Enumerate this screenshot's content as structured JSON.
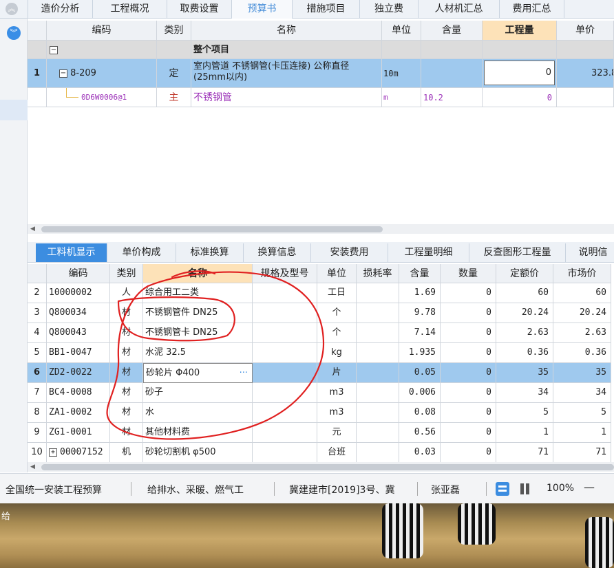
{
  "top_tabs": [
    "造价分析",
    "工程概况",
    "取费设置",
    "预算书",
    "措施项目",
    "独立费",
    "人材机汇总",
    "费用汇总"
  ],
  "top_tab_active": "预算书",
  "upper_grid": {
    "headers": [
      "编码",
      "类别",
      "名称",
      "单位",
      "含量",
      "工程量",
      "单价"
    ],
    "rows": [
      {
        "num": "",
        "code": "",
        "type": "",
        "name": "整个项目",
        "unit": "",
        "content": "",
        "qty": "",
        "price": ""
      },
      {
        "num": "1",
        "code": "8-209",
        "type": "定",
        "name_line1": "室内管道 不锈钢管(卡压连接) 公称直径",
        "name_line2": "(25mm以内)",
        "unit": "10m",
        "content": "",
        "qty": "0",
        "price": "323.8"
      },
      {
        "num": "",
        "code": "0D6W0006@1",
        "type": "主",
        "name": "不锈钢管",
        "unit": "m",
        "content": "10.2",
        "qty": "0",
        "price": ""
      }
    ],
    "expand_symbol": "−"
  },
  "lower_tabs": [
    "工料机显示",
    "单价构成",
    "标准换算",
    "换算信息",
    "安装费用",
    "工程量明细",
    "反查图形工程量",
    "说明信"
  ],
  "lower_tab_active": "工料机显示",
  "lower_grid": {
    "headers": [
      "编码",
      "类别",
      "名称",
      "规格及型号",
      "单位",
      "损耗率",
      "含量",
      "数量",
      "定额价",
      "市场价"
    ],
    "rows": [
      {
        "num": "2",
        "code": "10000002",
        "type": "人",
        "name": "综合用工二类",
        "spec": "",
        "unit": "工日",
        "loss": "",
        "content": "1.69",
        "qty": "0",
        "quota": "60",
        "market": "60"
      },
      {
        "num": "3",
        "code": "Q800034",
        "type": "材",
        "name": "不锈钢管件 DN25",
        "spec": "",
        "unit": "个",
        "loss": "",
        "content": "9.78",
        "qty": "0",
        "quota": "20.24",
        "market": "20.24"
      },
      {
        "num": "4",
        "code": "Q800043",
        "type": "材",
        "name": "不锈钢管卡 DN25",
        "spec": "",
        "unit": "个",
        "loss": "",
        "content": "7.14",
        "qty": "0",
        "quota": "2.63",
        "market": "2.63"
      },
      {
        "num": "5",
        "code": "BB1-0047",
        "type": "材",
        "name": "水泥 32.5",
        "spec": "",
        "unit": "kg",
        "loss": "",
        "content": "1.935",
        "qty": "0",
        "quota": "0.36",
        "market": "0.36"
      },
      {
        "num": "6",
        "code": "ZD2-0022",
        "type": "材",
        "name": "砂轮片 Φ400",
        "spec": "",
        "unit": "片",
        "loss": "",
        "content": "0.05",
        "qty": "0",
        "quota": "35",
        "market": "35"
      },
      {
        "num": "7",
        "code": "BC4-0008",
        "type": "材",
        "name": "砂子",
        "spec": "",
        "unit": "m3",
        "loss": "",
        "content": "0.006",
        "qty": "0",
        "quota": "34",
        "market": "34"
      },
      {
        "num": "8",
        "code": "ZA1-0002",
        "type": "材",
        "name": "水",
        "spec": "",
        "unit": "m3",
        "loss": "",
        "content": "0.08",
        "qty": "0",
        "quota": "5",
        "market": "5"
      },
      {
        "num": "9",
        "code": "ZG1-0001",
        "type": "材",
        "name": "其他材料费",
        "spec": "",
        "unit": "元",
        "loss": "",
        "content": "0.56",
        "qty": "0",
        "quota": "1",
        "market": "1"
      },
      {
        "num": "10",
        "code": "00007152",
        "type": "机",
        "name": "砂轮切割机 φ500",
        "spec": "",
        "unit": "台班",
        "loss": "",
        "content": "0.03",
        "qty": "0",
        "quota": "71",
        "market": "71"
      }
    ],
    "ellipsis": "···",
    "plus_symbol": "+"
  },
  "status_bar": {
    "item1": "全国统一安装工程预算",
    "item2": "给排水、采暖、燃气工",
    "item3": "冀建建市[2019]3号、冀",
    "item4": "张亚磊",
    "zoom": "100%",
    "zoom_minus": "—"
  },
  "desktop_text": "给",
  "icons": {
    "collapse": "chevron-up-icon",
    "down": "chevron-down-icon"
  },
  "colors": {
    "accent": "#3c8de0",
    "selected_row": "#9fc9ee",
    "purple_text": "#9b30b8",
    "annotation": "#e02020"
  }
}
